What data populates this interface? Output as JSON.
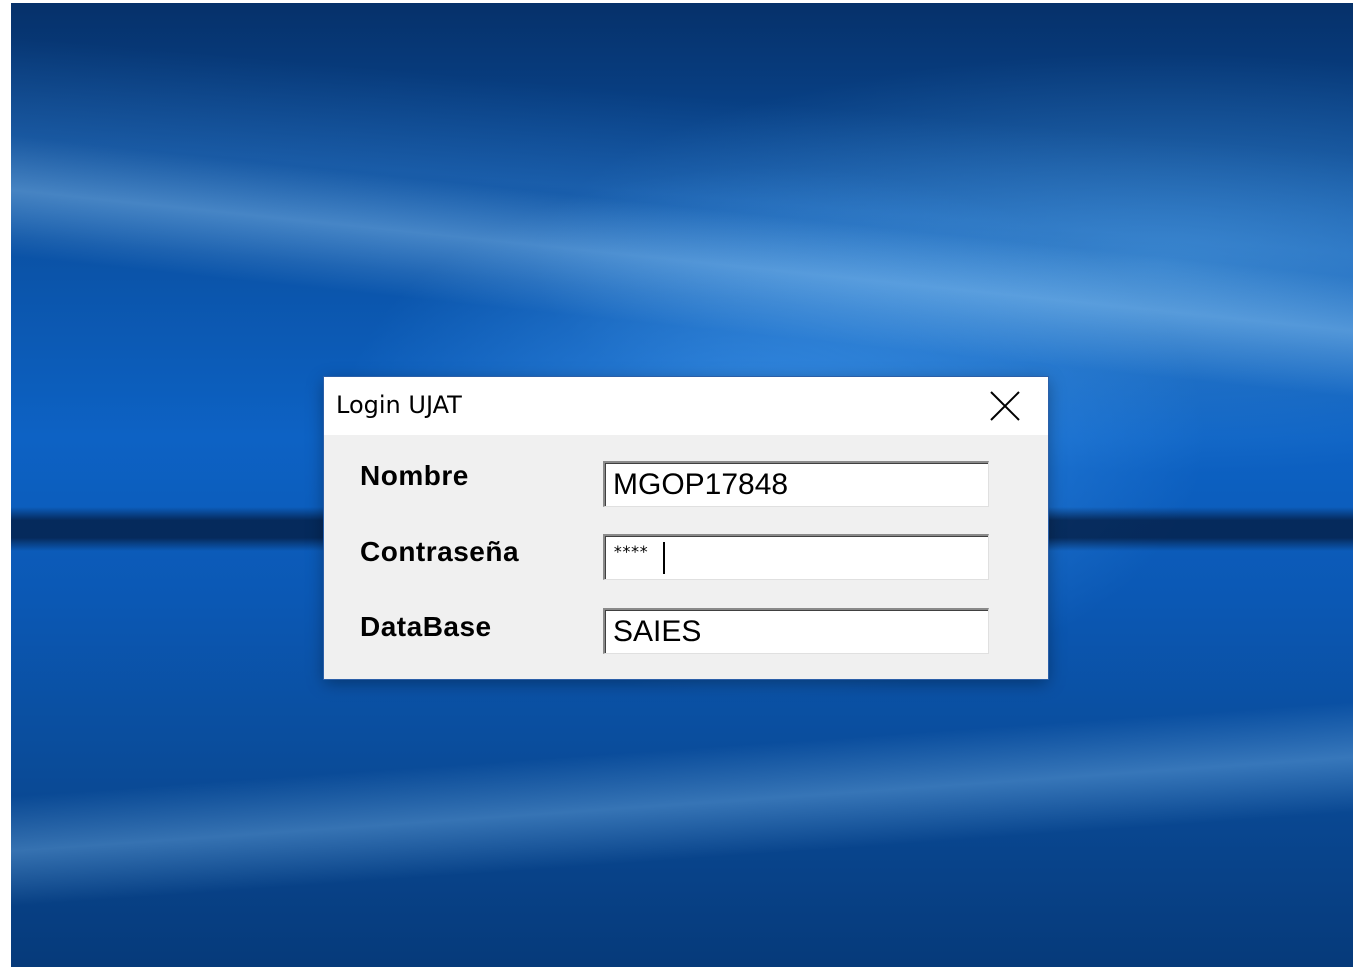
{
  "window": {
    "title": "Login UJAT",
    "close_icon": "close-icon"
  },
  "form": {
    "nombre": {
      "label": "Nombre",
      "value": "MGOP17848"
    },
    "contrasena": {
      "label": "Contraseña",
      "value_masked": "****"
    },
    "database": {
      "label": "DataBase",
      "value": "SAIES"
    }
  },
  "colors": {
    "dialog_background": "#f0f0f0",
    "titlebar_background": "#ffffff",
    "desktop_accent": "#0d62c4"
  }
}
